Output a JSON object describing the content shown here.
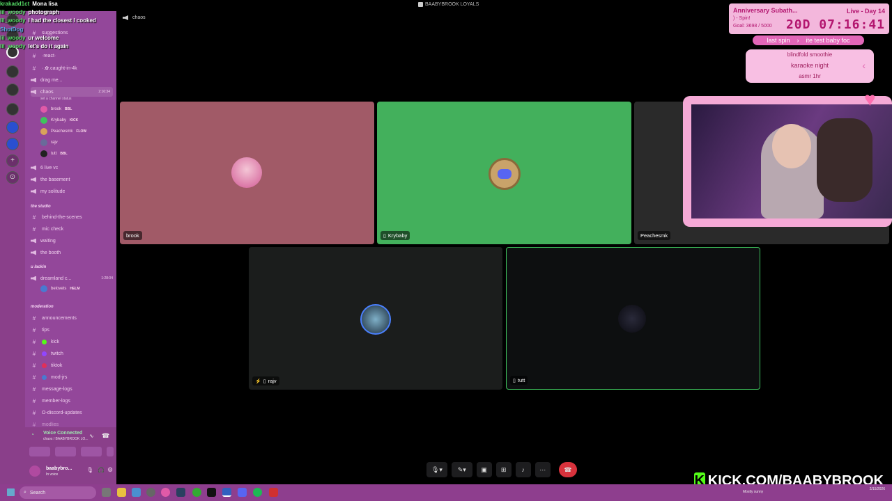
{
  "window": {
    "title": "BAABYBROOK LOYALS"
  },
  "chat_overlay": [
    {
      "user": "krakadd1ct",
      "msg": "Mona lisa"
    },
    {
      "user": "lil_woody",
      "msg": "photograph"
    },
    {
      "user": "lil_woody",
      "msg": "I had the closest I cooked"
    },
    {
      "user": "ShotDog",
      "msg": ""
    },
    {
      "user": "lil_woody",
      "msg": "ur welcome"
    },
    {
      "user": "lil_woody",
      "msg": "let's do it again"
    }
  ],
  "sidebar": {
    "server_name": "BAABYBROOK LOY...",
    "channels_top": [
      {
        "icon": "hash",
        "label": "suggestions"
      },
      {
        "icon": "hash",
        "label": "·react·"
      },
      {
        "icon": "hash",
        "label": "·.✿.caught-in-4k"
      },
      {
        "icon": "speaker",
        "label": "drag me..."
      }
    ],
    "active_voice": {
      "label": "chaos",
      "time": "2:16:34",
      "status": "set a channel status"
    },
    "members": [
      {
        "name": "brook",
        "tag": "BBL",
        "color": "#e05aa8"
      },
      {
        "name": "Krybaby",
        "tag": "KICK",
        "color": "#3ec45d"
      },
      {
        "name": "Peachesmk",
        "tag": "FLOW",
        "color": "#d9a35a"
      },
      {
        "name": "rajv",
        "tag": "",
        "color": "#6a6a9a"
      },
      {
        "name": "tutt",
        "tag": "BBL",
        "color": "#222222"
      }
    ],
    "voice_channels": [
      {
        "label": "6 live vc"
      },
      {
        "label": "the basement"
      },
      {
        "label": "my solitude"
      }
    ],
    "cat_studio": "the studio",
    "studio_channels": [
      {
        "icon": "hash",
        "label": "behind-the-scenes"
      },
      {
        "icon": "hash",
        "label": "mic check"
      },
      {
        "icon": "speaker",
        "label": "waiting"
      },
      {
        "icon": "speaker",
        "label": "the booth"
      }
    ],
    "cat_lackin": "u lackin",
    "lackin_voice": {
      "label": "dreamland c...",
      "time": "1:28:04"
    },
    "lackin_member": {
      "name": "belovets",
      "tag": "HELM"
    },
    "cat_moderation": "moderation",
    "mod_channels": [
      {
        "label": "announcements",
        "dot": ""
      },
      {
        "label": "tips",
        "dot": ""
      },
      {
        "label": "kick",
        "dot": "#53fc18"
      },
      {
        "label": "twitch",
        "dot": "#9146ff"
      },
      {
        "label": "tiktok",
        "dot": "#e0305a"
      },
      {
        "label": "mod-jrs",
        "dot": "#4a7ad0"
      },
      {
        "label": "message-logs",
        "dot": ""
      },
      {
        "label": "member-logs",
        "dot": ""
      },
      {
        "label": "O-discord-updates",
        "dot": ""
      },
      {
        "label": "modlies",
        "dot": ""
      }
    ]
  },
  "voice_panel": {
    "title": "Voice Connected",
    "sub": "chaos / BAABYBROOK LO...",
    "user": "baabybro...",
    "status": "In voice"
  },
  "stage": {
    "channel_name": "chaos",
    "tiles": [
      {
        "name": "brook",
        "bg": "#a15a67"
      },
      {
        "name": "Krybaby",
        "bg": "#43b05c"
      },
      {
        "name": "Peachesmk",
        "bg": "#2a2a2a"
      },
      {
        "name": "rajv",
        "bg": "#1b1d1c"
      },
      {
        "name": "tutt",
        "bg": "#0d0f10"
      }
    ]
  },
  "goal_widget": {
    "name": "Anniversary Subath...",
    "sub": ") - Spin!",
    "goal": "Goal: 3698 / 5000",
    "live": "Live - Day 14",
    "timer": "20D 07:16:41"
  },
  "spin_wheel": {
    "bar_left": "last spin",
    "bar_right": "ite test baby foc",
    "items": [
      "blindfold smoothie",
      "karaoke night",
      "asmr 1hr"
    ]
  },
  "kick_banner": {
    "url": "KICK.COM/BAABYBROOK"
  },
  "taskbar": {
    "search": "Search",
    "weather": "Mostly sunny",
    "date": "2/15/2026"
  }
}
